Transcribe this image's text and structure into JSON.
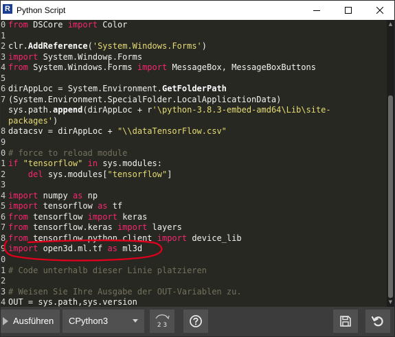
{
  "window": {
    "title": "Python Script",
    "app_icon_letter": "R"
  },
  "editor": {
    "lines": [
      {
        "n": "0",
        "tokens": [
          {
            "t": "kw",
            "v": "from"
          },
          {
            "t": "pl",
            "v": " DSCore "
          },
          {
            "t": "kw",
            "v": "import"
          },
          {
            "t": "pl",
            "v": " Color"
          }
        ]
      },
      {
        "n": "1",
        "tokens": []
      },
      {
        "n": "2",
        "tokens": [
          {
            "t": "pl",
            "v": "clr."
          },
          {
            "t": "fn",
            "v": "AddReference"
          },
          {
            "t": "pl",
            "v": "("
          },
          {
            "t": "str",
            "v": "'System.Windows.Forms'"
          },
          {
            "t": "pl",
            "v": ")"
          }
        ]
      },
      {
        "n": "3",
        "tokens": [
          {
            "t": "kw",
            "v": "import"
          },
          {
            "t": "pl",
            "v": " System.Windows.Forms"
          }
        ]
      },
      {
        "n": "4",
        "tokens": [
          {
            "t": "kw",
            "v": "from"
          },
          {
            "t": "pl",
            "v": " System.Windows.Forms "
          },
          {
            "t": "kw",
            "v": "import"
          },
          {
            "t": "pl",
            "v": " MessageBox, MessageBoxButtons"
          }
        ]
      },
      {
        "n": "5",
        "tokens": []
      },
      {
        "n": "6",
        "tokens": [
          {
            "t": "pl",
            "v": "dirAppLoc = System.Environment."
          },
          {
            "t": "fn",
            "v": "GetFolderPath"
          }
        ]
      },
      {
        "n": "7",
        "tokens": [
          {
            "t": "pl",
            "v": "(System.Environment.SpecialFolder.LocalApplicationData)"
          }
        ]
      },
      {
        "n": "",
        "tokens": [
          {
            "t": "pl",
            "v": "sys.path."
          },
          {
            "t": "fn",
            "v": "append"
          },
          {
            "t": "pl",
            "v": "(dirAppLoc + r"
          },
          {
            "t": "str",
            "v": "'\\python-3.8.3-embed-amd64\\Lib\\site-"
          }
        ]
      },
      {
        "n": "",
        "tokens": [
          {
            "t": "str",
            "v": "packages'"
          },
          {
            "t": "pl",
            "v": ")"
          }
        ]
      },
      {
        "n": "8",
        "tokens": [
          {
            "t": "pl",
            "v": "datacsv = dirAppLoc + "
          },
          {
            "t": "str",
            "v": "\"\\\\dataTensorFlow.csv\""
          }
        ]
      },
      {
        "n": "9",
        "tokens": []
      },
      {
        "n": "0",
        "tokens": [
          {
            "t": "cmt",
            "v": "# force to reload module"
          }
        ]
      },
      {
        "n": "1",
        "tokens": [
          {
            "t": "kw",
            "v": "if"
          },
          {
            "t": "pl",
            "v": " "
          },
          {
            "t": "str",
            "v": "\"tensorflow\""
          },
          {
            "t": "pl",
            "v": " "
          },
          {
            "t": "kw",
            "v": "in"
          },
          {
            "t": "pl",
            "v": " sys.modules:"
          }
        ]
      },
      {
        "n": "2",
        "tokens": [
          {
            "t": "pl",
            "v": "    "
          },
          {
            "t": "kw",
            "v": "del"
          },
          {
            "t": "pl",
            "v": " sys.modules["
          },
          {
            "t": "str",
            "v": "\"tensorflow\""
          },
          {
            "t": "pl",
            "v": "]"
          }
        ]
      },
      {
        "n": "3",
        "tokens": []
      },
      {
        "n": "4",
        "tokens": [
          {
            "t": "kw",
            "v": "import"
          },
          {
            "t": "pl",
            "v": " numpy "
          },
          {
            "t": "kw",
            "v": "as"
          },
          {
            "t": "pl",
            "v": " np"
          }
        ]
      },
      {
        "n": "5",
        "tokens": [
          {
            "t": "kw",
            "v": "import"
          },
          {
            "t": "pl",
            "v": " tensorflow "
          },
          {
            "t": "kw",
            "v": "as"
          },
          {
            "t": "pl",
            "v": " tf"
          }
        ]
      },
      {
        "n": "6",
        "tokens": [
          {
            "t": "kw",
            "v": "from"
          },
          {
            "t": "pl",
            "v": " tensorflow "
          },
          {
            "t": "kw",
            "v": "import"
          },
          {
            "t": "pl",
            "v": " keras"
          }
        ]
      },
      {
        "n": "7",
        "tokens": [
          {
            "t": "kw",
            "v": "from"
          },
          {
            "t": "pl",
            "v": " tensorflow.keras "
          },
          {
            "t": "kw",
            "v": "import"
          },
          {
            "t": "pl",
            "v": " layers"
          }
        ]
      },
      {
        "n": "8",
        "tokens": [
          {
            "t": "kw",
            "v": "from"
          },
          {
            "t": "pl",
            "v": " tensorflow.python.client "
          },
          {
            "t": "kw",
            "v": "import"
          },
          {
            "t": "pl",
            "v": " device_lib"
          }
        ]
      },
      {
        "n": "9",
        "tokens": [
          {
            "t": "kw",
            "v": "import"
          },
          {
            "t": "pl",
            "v": " open3d.ml.tf "
          },
          {
            "t": "kw",
            "v": "as"
          },
          {
            "t": "pl",
            "v": " ml3d"
          }
        ]
      },
      {
        "n": "0",
        "tokens": []
      },
      {
        "n": "1",
        "tokens": [
          {
            "t": "cmt",
            "v": "# Code unterhalb dieser Linie platzieren"
          }
        ]
      },
      {
        "n": "2",
        "tokens": []
      },
      {
        "n": "3",
        "tokens": [
          {
            "t": "cmt",
            "v": "# Weisen Sie Ihre Ausgabe der OUT-Variablen zu."
          }
        ]
      },
      {
        "n": "4",
        "tokens": [
          {
            "t": "pl",
            "v": "OUT = sys.path,sys.version"
          }
        ]
      }
    ]
  },
  "toolbar": {
    "run_label": "Ausführen",
    "engine_value": "CPython3",
    "numbers_label": "2 3"
  },
  "colors": {
    "editor_bg": "#272822",
    "keyword": "#f92672",
    "string": "#e6db74",
    "comment": "#75715e",
    "annotation": "#e0001b",
    "toolbar_bg": "#3c3c3c"
  },
  "icons": {
    "app": "revit-icon",
    "run": "play-icon",
    "dropdown": "chevron-down-icon",
    "help": "question-circle-icon",
    "save": "floppy-disk-icon",
    "reset": "undo-arrow-icon"
  }
}
